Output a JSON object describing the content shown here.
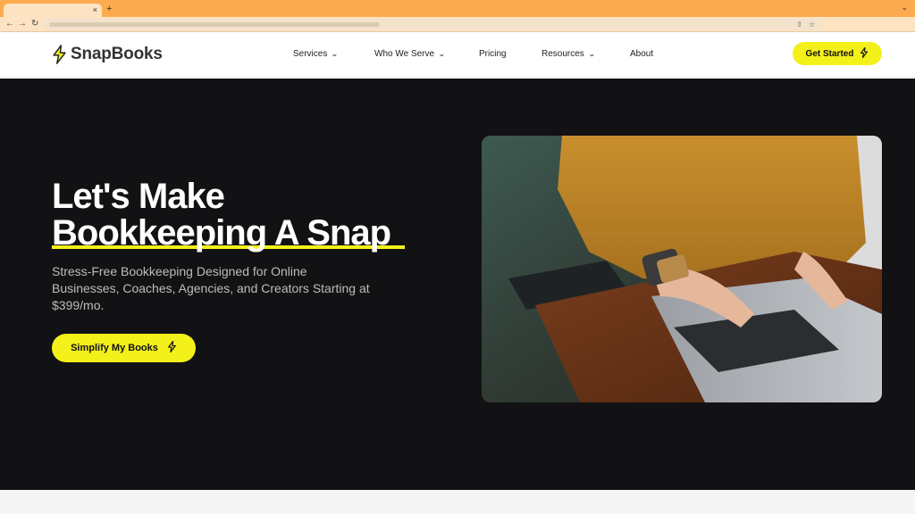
{
  "browser": {
    "tab_close": "×",
    "new_tab": "+",
    "menu_chevron": "⌄",
    "back": "←",
    "forward": "→",
    "reload": "↻",
    "share_icon": "share-icon",
    "star_icon": "star-icon"
  },
  "header": {
    "logo_text": "SnapBooks",
    "nav": [
      {
        "label": "Services",
        "has_caret": true
      },
      {
        "label": "Who We Serve",
        "has_caret": true
      },
      {
        "label": "Pricing",
        "has_caret": false
      },
      {
        "label": "Resources",
        "has_caret": true
      },
      {
        "label": "About",
        "has_caret": false
      }
    ],
    "cta_label": "Get Started"
  },
  "hero": {
    "title_line1": "Let's Make",
    "title_line2": "Bookkeeping A Snap",
    "subtitle": "Stress-Free Bookkeeping Designed for Online Businesses, Coaches, Agencies, and Creators Starting at $399/mo.",
    "cta_label": "Simplify My Books",
    "photo_icon": "laptop-photo"
  },
  "colors": {
    "accent": "#f4f01a",
    "hero_bg": "#121214",
    "browser_tab_bar": "#fcab4e"
  }
}
